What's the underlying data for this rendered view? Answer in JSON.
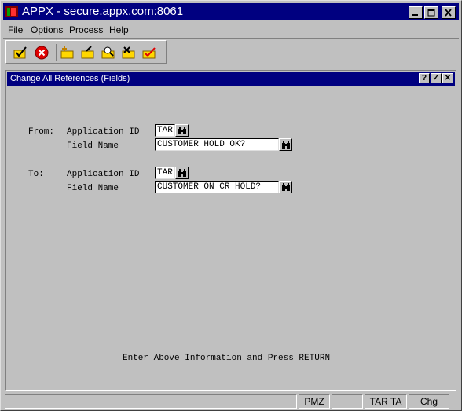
{
  "window": {
    "title": "APPX - secure.appx.com:8061",
    "controls": {
      "minimize": "minimize-icon",
      "maximize": "maximize-icon",
      "close": "close-icon"
    }
  },
  "menu": {
    "items": [
      {
        "label": "File"
      },
      {
        "label": "Options"
      },
      {
        "label": "Process"
      },
      {
        "label": "Help"
      }
    ]
  },
  "toolbar": {
    "tools": [
      {
        "icon": "check-folder-icon"
      },
      {
        "icon": "cancel-icon"
      },
      {
        "icon": "add-record-icon"
      },
      {
        "icon": "change-record-icon"
      },
      {
        "icon": "inquire-record-icon"
      },
      {
        "icon": "delete-record-icon"
      },
      {
        "icon": "cancel-record-icon"
      }
    ]
  },
  "dialog": {
    "title": "Change All References (Fields)",
    "buttons": {
      "help": "?",
      "ok": "✓",
      "close": "✕"
    },
    "from": {
      "section_label": "From:",
      "app_id_label": "Application ID",
      "app_id_value": "TAR",
      "field_name_label": "Field Name",
      "field_name_value": "CUSTOMER HOLD OK?"
    },
    "to": {
      "section_label": "To:",
      "app_id_label": "Application ID",
      "app_id_value": "TAR",
      "field_name_label": "Field Name",
      "field_name_value": "CUSTOMER ON CR HOLD?"
    },
    "prompt": "Enter Above Information and Press RETURN"
  },
  "status": {
    "panels": [
      "",
      "PMZ",
      "",
      "TAR TA",
      "Chg"
    ]
  },
  "colors": {
    "titlebar": "#000080",
    "face": "#c0c0c0",
    "field_bg": "#ffffff"
  }
}
